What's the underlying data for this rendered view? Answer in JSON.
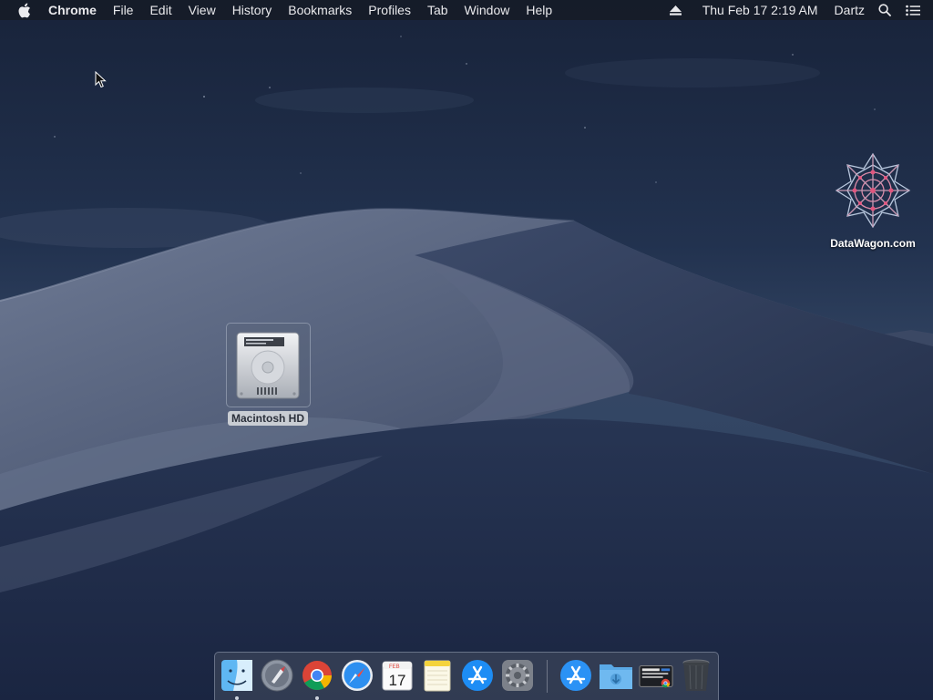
{
  "menubar": {
    "app_name": "Chrome",
    "menus": [
      "File",
      "Edit",
      "View",
      "History",
      "Bookmarks",
      "Profiles",
      "Tab",
      "Window",
      "Help"
    ],
    "clock": "Thu Feb 17  2:19 AM",
    "user": "Dartz",
    "status_icons": [
      "eject-icon",
      "spotlight-search-icon",
      "notification-center-icon"
    ]
  },
  "desktop": {
    "icons": [
      {
        "label": "Macintosh HD",
        "icon": "hard-drive-icon",
        "selected": true
      },
      {
        "label": "DataWagon.com",
        "icon": "datawagon-logo-icon",
        "selected": false
      }
    ]
  },
  "dock": {
    "items": [
      {
        "name": "Finder",
        "icon": "finder-icon",
        "running": true
      },
      {
        "name": "Launchpad",
        "icon": "launchpad-icon",
        "running": false
      },
      {
        "name": "Google Chrome",
        "icon": "chrome-icon",
        "running": true
      },
      {
        "name": "Safari",
        "icon": "safari-icon",
        "running": false
      },
      {
        "name": "Calendar",
        "icon": "calendar-icon",
        "running": false,
        "month": "FEB",
        "day": "17"
      },
      {
        "name": "Notes",
        "icon": "notes-icon",
        "running": false
      },
      {
        "name": "App Store",
        "icon": "app-store-icon",
        "running": false
      },
      {
        "name": "System Preferences",
        "icon": "system-preferences-icon",
        "running": false
      },
      {
        "name": "Applications",
        "icon": "applications-folder-icon",
        "running": false
      },
      {
        "name": "Downloads",
        "icon": "downloads-folder-icon",
        "running": false
      },
      {
        "name": "Recent document",
        "icon": "recent-document-stack-icon",
        "running": false
      },
      {
        "name": "Trash",
        "icon": "trash-icon",
        "running": false
      }
    ]
  },
  "colors": {
    "menubar_bg": "#161c28",
    "label_selected_bg": "#c9cdd3",
    "sky_top": "#1a2740",
    "sky_bottom": "#2f4263"
  }
}
